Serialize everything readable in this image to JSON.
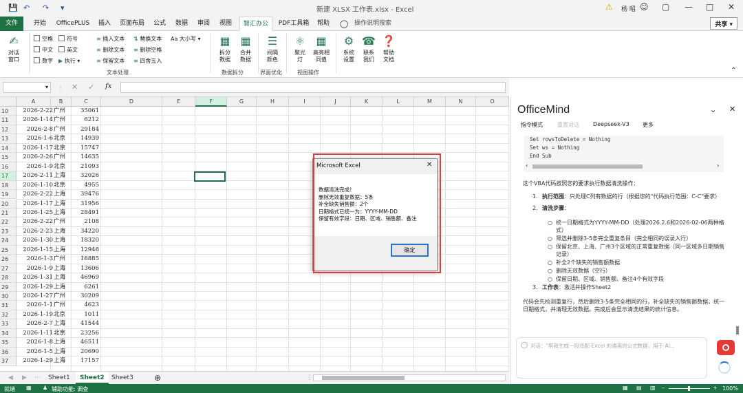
{
  "window": {
    "title": "新建 XLSX 工作表.xlsx - Excel",
    "user": "杨 昭",
    "share": "共享"
  },
  "tabs": [
    "文件",
    "开始",
    "OfficePLUS",
    "插入",
    "页面布局",
    "公式",
    "数据",
    "审阅",
    "视图",
    "智汇办公",
    "PDF工具箱",
    "帮助",
    "操作说明搜索"
  ],
  "ribbon": {
    "dialog_window": "对话\n窗口",
    "checks": [
      "空格",
      "符号",
      "中文",
      "英文",
      "数字"
    ],
    "exec": "执行",
    "text_ops": [
      "插入文本",
      "删除文本",
      "保留文本",
      "替换文本",
      "删除空格",
      "四舍五入"
    ],
    "case": "Aa 大小写",
    "group_text": "文本处理",
    "split": [
      "拆分\n数据",
      "合并\n数据"
    ],
    "group_split": "数据拆分",
    "interval": "间隔\n颜色",
    "group_ui": "界面优化",
    "spotlight": "聚光\n灯",
    "highlight": "高亮相\n同值",
    "group_view": "视图操作",
    "sys": "系统\n设置",
    "contact": "联系\n我们",
    "help": "帮助\n文档"
  },
  "formula": {
    "fx": "fx"
  },
  "columns": [
    "A",
    "B",
    "C",
    "D",
    "E",
    "F",
    "G",
    "H",
    "I",
    "J",
    "K",
    "L",
    "M",
    "N",
    "O"
  ],
  "rows": [
    {
      "n": "10",
      "a": "2026-2-22",
      "b": "广州",
      "c": "35061"
    },
    {
      "n": "11",
      "a": "2026-1-14",
      "b": "广州",
      "c": "6212"
    },
    {
      "n": "12",
      "a": "2026-2-8",
      "b": "广州",
      "c": "29184"
    },
    {
      "n": "13",
      "a": "2026-1-6",
      "b": "北京",
      "c": "14939"
    },
    {
      "n": "14",
      "a": "2026-1-17",
      "b": "北京",
      "c": "15747"
    },
    {
      "n": "15",
      "a": "2026-2-26",
      "b": "广州",
      "c": "14635"
    },
    {
      "n": "16",
      "a": "2026-1-9",
      "b": "北京",
      "c": "21093"
    },
    {
      "n": "17",
      "a": "2026-2-11",
      "b": "上海",
      "c": "32026"
    },
    {
      "n": "18",
      "a": "2026-1-10",
      "b": "北京",
      "c": "4955"
    },
    {
      "n": "19",
      "a": "2026-2-22",
      "b": "上海",
      "c": "39476"
    },
    {
      "n": "20",
      "a": "2026-1-17",
      "b": "上海",
      "c": "31956"
    },
    {
      "n": "21",
      "a": "2026-1-25",
      "b": "上海",
      "c": "28491"
    },
    {
      "n": "22",
      "a": "2026-2-22",
      "b": "广州",
      "c": "2108"
    },
    {
      "n": "23",
      "a": "2026-2-23",
      "b": "上海",
      "c": "34220"
    },
    {
      "n": "24",
      "a": "2026-1-30",
      "b": "上海",
      "c": "18320"
    },
    {
      "n": "25",
      "a": "2026-1-15",
      "b": "上海",
      "c": "12948"
    },
    {
      "n": "26",
      "a": "2026-1-3",
      "b": "广州",
      "c": "18885"
    },
    {
      "n": "27",
      "a": "2026-1-9",
      "b": "上海",
      "c": "13606"
    },
    {
      "n": "28",
      "a": "2026-1-31",
      "b": "上海",
      "c": "46969"
    },
    {
      "n": "29",
      "a": "2026-1-29",
      "b": "上海",
      "c": "6261"
    },
    {
      "n": "30",
      "a": "2026-1-27",
      "b": "广州",
      "c": "30209"
    },
    {
      "n": "31",
      "a": "2026-1-1",
      "b": "广州",
      "c": "4623"
    },
    {
      "n": "32",
      "a": "2026-1-19",
      "b": "北京",
      "c": "1011"
    },
    {
      "n": "33",
      "a": "2026-2-7",
      "b": "上海",
      "c": "41544"
    },
    {
      "n": "34",
      "a": "2026-1-11",
      "b": "北京",
      "c": "23256"
    },
    {
      "n": "35",
      "a": "2026-1-8",
      "b": "上海",
      "c": "46511"
    },
    {
      "n": "36",
      "a": "2026-1-5",
      "b": "上海",
      "c": "20690"
    },
    {
      "n": "37",
      "a": "2026-1-29",
      "b": "上海",
      "c": "17157"
    }
  ],
  "sheets": [
    "Sheet1",
    "Sheet2",
    "Sheet3"
  ],
  "status": {
    "ready": "就绪",
    "accessibility": "辅助功能: 调查",
    "zoom": "100%"
  },
  "dialog": {
    "title": "Microsoft Excel",
    "lines": [
      "数据清洗完成！",
      "删除无效重复数据：5条",
      "补全缺失销售额：2个",
      "日期格式已统一为：YYYY-MM-DD",
      "保留有效字段：日期、区域、销售额、备注"
    ],
    "ok": "确定"
  },
  "panel": {
    "title": "OfficeMind",
    "tabs": [
      "指令模式",
      "重置对话",
      "Deepseek-V3",
      "更多"
    ],
    "code": [
      "    Set rowsToDelete = Nothing",
      "    Set ws = Nothing",
      "End Sub"
    ],
    "intro": "这个VBA代码按照您的要求执行数据清洗操作：",
    "item1_title": "执行范围",
    "item1": "：只处理C列有数据的行（根据您的\"代码执行范围：C-C\"要求）",
    "item2_title": "清洗步骤",
    "steps": [
      "统一日期格式为YYYY-MM-DD（处理2026.2.6和2026-02-06两种格式）",
      "筛选并删除3-5条完全重复条目（完全相同的误录入行）",
      "保留北京、上海、广州3个区域的正常重复数据（同一区域多日期销售记录）",
      "补全2个缺失的销售额数据",
      "删除无效数据（空行）",
      "保留日期、区域、销售额、备注4个有效字段"
    ],
    "item3_title": "工作表",
    "item3": "：激活并操作Sheet2",
    "summary": "代码会先检测重复行，然后删除3-5条完全相同的行，补全缺失的销售额数据，统一日期格式，并清理无效数据。完成后会显示清洗结果的统计信息。",
    "input_placeholder": "对话：\"帮我生成一段适配 Excel 的通用的公式数据，用于 AI..."
  },
  "colors": {
    "excel_green": "#1e7145",
    "dialog_highlight": "#e0393e",
    "record": "#e53935"
  }
}
